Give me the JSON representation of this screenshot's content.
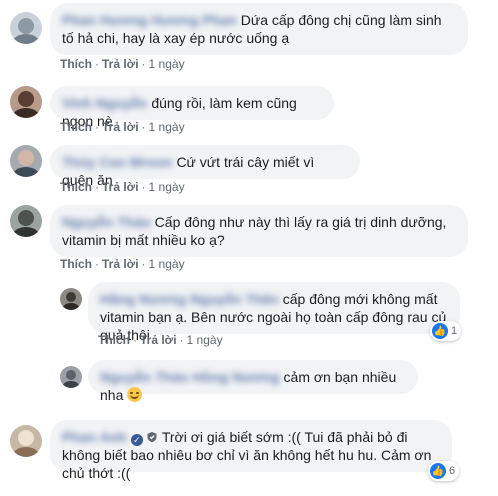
{
  "comments": [
    {
      "author": "Phan Hương Hương Phan",
      "text": "Dứa cấp đông chị cũng làm sinh tố hả chi, hay là xay ép nước uống ạ",
      "actions": {
        "like": "Thích",
        "reply": "Trả lời",
        "time": "1 ngày"
      }
    },
    {
      "author": "Vinh Nguyễn",
      "text": "đúng rồi, làm kem cũng ngon nè",
      "actions": {
        "like": "Thích",
        "reply": "Trả lời",
        "time": "1 ngày"
      }
    },
    {
      "author": "Thúy Cao Mroon",
      "text": "Cứ vứt trái cây miết vì quên ăn",
      "actions": {
        "like": "Thích",
        "reply": "Trả lời",
        "time": "1 ngày"
      }
    },
    {
      "author": "Nguyễn Thảo",
      "text": "Cấp đông như này thì lấy ra giá trị dinh dưỡng, vitamin bị mất nhiều ko ạ?",
      "actions": {
        "like": "Thích",
        "reply": "Trả lời",
        "time": "1 ngày"
      }
    },
    {
      "author": "Hằng Nương Nguyễn Thân",
      "text": "cấp đông mới không mất vitamin bạn ạ. Bên nước ngoài họ toàn cấp đông rau củ quả thôi",
      "reaction_count": "1",
      "actions": {
        "like": "Thích",
        "reply": "Trả lời",
        "time": "1 ngày"
      }
    },
    {
      "author": "Nguyễn Thảo Hồng Nương",
      "text": "cảm ơn bạn nhiều nha",
      "emoji": "smiling-face"
    },
    {
      "author": "Phan Anh",
      "text": "Trời ơi giá biết sớm :(( Tui đã phải bỏ đi không biết bao nhiêu bơ chỉ vì ăn không hết hu hu. Cảm ơn chủ thớt :((",
      "reaction_count": "6"
    }
  ]
}
